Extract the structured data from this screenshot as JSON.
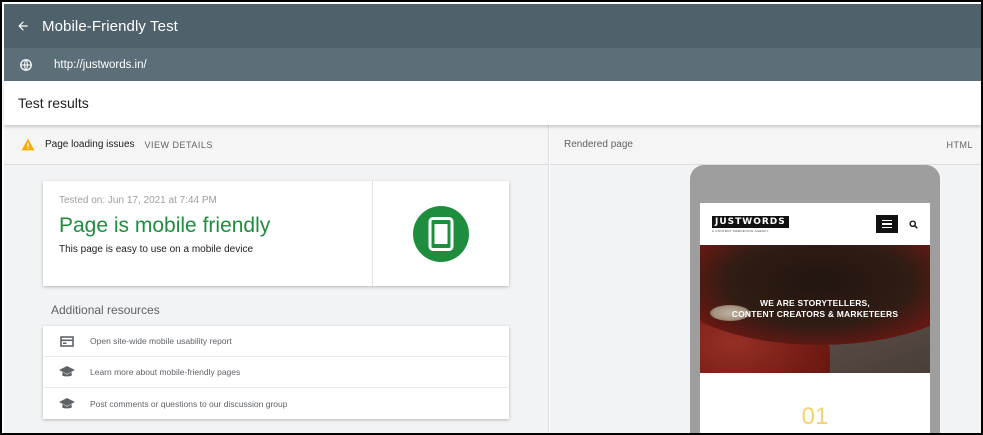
{
  "header": {
    "title": "Mobile-Friendly Test",
    "url": "http://justwords.in/"
  },
  "results": {
    "title": "Test results",
    "issues_label": "Page loading issues",
    "view_details": "VIEW DETAILS",
    "tested_on": "Tested on: Jun 17, 2021 at 7:44 PM",
    "verdict": "Page is mobile friendly",
    "verdict_sub": "This page is easy to use on a mobile device",
    "verdict_color": "#1e8e3e"
  },
  "resources": {
    "title": "Additional resources",
    "items": [
      {
        "label": "Open site-wide mobile usability report",
        "icon": "report-icon"
      },
      {
        "label": "Learn more about mobile-friendly pages",
        "icon": "school-icon"
      },
      {
        "label": "Post comments or questions to our discussion group",
        "icon": "school-icon"
      }
    ]
  },
  "rendered": {
    "label": "Rendered page",
    "html_tab": "HTML",
    "site": {
      "logo": "JUSTWORDS",
      "logo_sub": "A CONTENT MARKETING AGENCY",
      "hero_line1": "WE ARE STORYTELLERS,",
      "hero_line2": "CONTENT CREATORS & MARKETEERS",
      "section_number": "01",
      "accent": "#f5d36a"
    }
  },
  "colors": {
    "topbar": "#4f616b",
    "urlbar": "#5c6f79",
    "warning": "#f9ab00"
  }
}
